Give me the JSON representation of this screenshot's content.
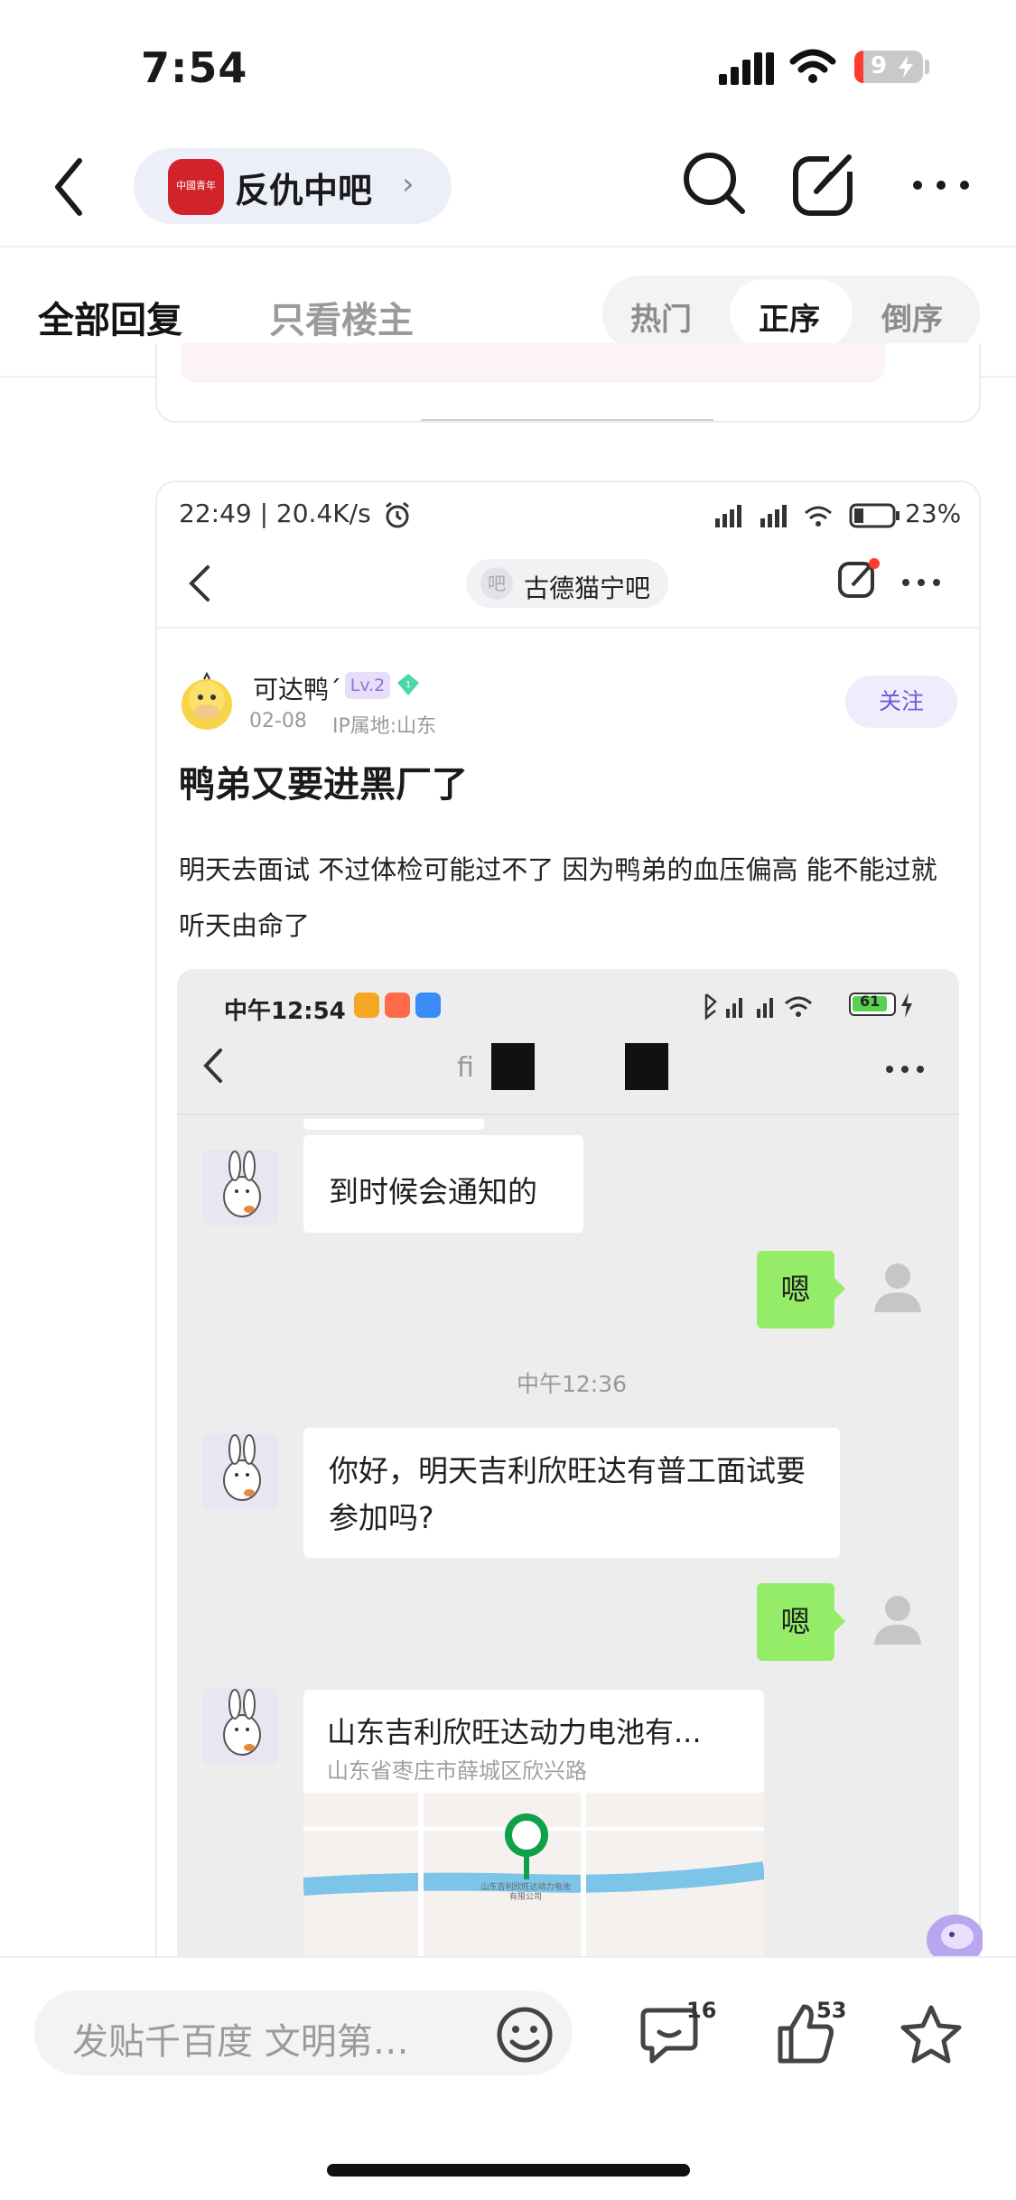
{
  "status_bar": {
    "time": "7:54",
    "battery": "9"
  },
  "nav": {
    "forum_name": "反仇中吧",
    "forum_logo_text": "中國青年"
  },
  "tabs": {
    "all": "全部回复",
    "op_only": "只看楼主"
  },
  "sort": {
    "options": [
      "热门",
      "正序",
      "倒序"
    ],
    "selected": "正序"
  },
  "post_screenshot": {
    "status": {
      "time": "22:49 | 20.4K/s",
      "battery": "23%"
    },
    "forum_name": "古德猫宁吧",
    "forum_icon_text": "吧",
    "author": {
      "name": "可达鸭´",
      "level": "Lv.2",
      "badge": "1",
      "date": "02-08",
      "ip": "IP属地:山东"
    },
    "follow_label": "关注",
    "title": "鸭弟又要进黑厂了",
    "body": "明天去面试 不过体检可能过不了 因为鸭弟的血压偏高 能不能过就听天由命了",
    "chat": {
      "status_time": "中午12:54",
      "battery": "61",
      "header_partial": "fi",
      "messages": [
        {
          "side": "left",
          "text": "到时候会通知的"
        },
        {
          "side": "right",
          "text": "嗯"
        },
        {
          "timestamp": "中午12:36"
        },
        {
          "side": "left",
          "text": "你好，明天吉利欣旺达有普工面试要参加吗?"
        },
        {
          "side": "right",
          "text": "嗯"
        },
        {
          "side": "left",
          "type": "location",
          "title": "山东吉利欣旺达动力电池有...",
          "address": "山东省枣庄市薛城区欣兴路",
          "pin_label": "山东吉利欣旺达动力电池有限公司"
        }
      ]
    }
  },
  "bottom_bar": {
    "input_placeholder": "发贴千百度 文明第…",
    "comment_count": "16",
    "like_count": "53"
  },
  "colors": {
    "accent_green": "#95ec69",
    "pin_green": "#10a04a",
    "follow_purple": "#6c5bd8",
    "logo_red": "#d2232a"
  }
}
